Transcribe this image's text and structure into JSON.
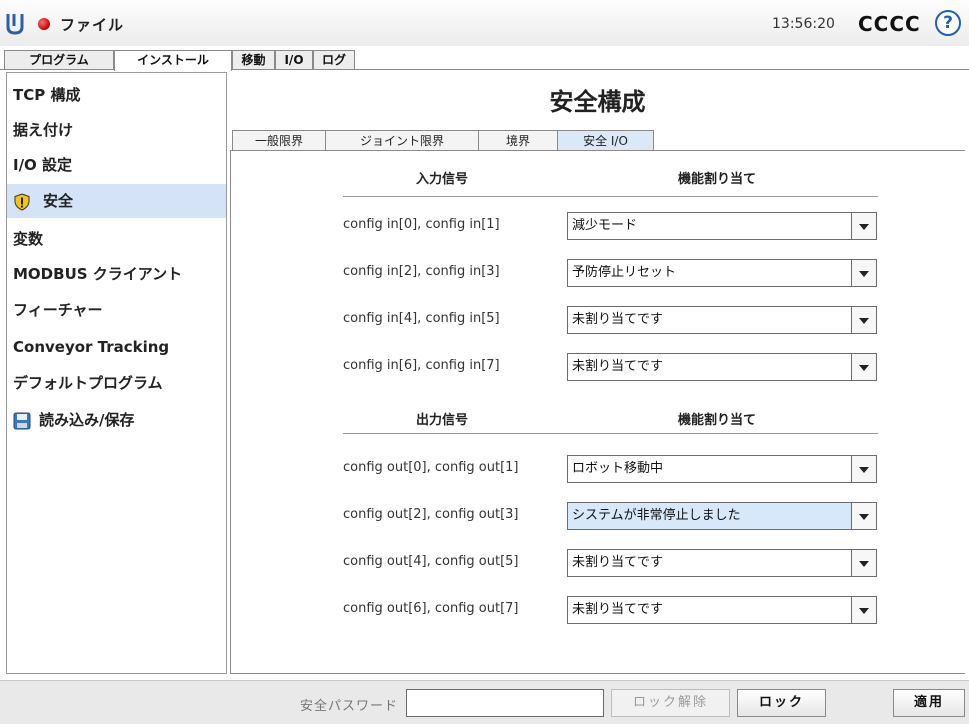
{
  "titlebar": {
    "file_menu": "ファイル",
    "clock": "13:56:20",
    "robot_name": "CCCC",
    "help_label": "?"
  },
  "top_tabs": [
    "プログラム",
    "インストール",
    "移動",
    "I/O",
    "ログ"
  ],
  "nav": {
    "items": [
      {
        "label": "TCP 構成",
        "icon": ""
      },
      {
        "label": "据え付け",
        "icon": ""
      },
      {
        "label": "I/O 設定",
        "icon": ""
      },
      {
        "label": "安全",
        "icon": "warning-icon"
      },
      {
        "label": "変数",
        "icon": ""
      },
      {
        "label": "MODBUS クライアント",
        "icon": ""
      },
      {
        "label": "フィーチャー",
        "icon": ""
      },
      {
        "label": "Conveyor Tracking",
        "icon": ""
      },
      {
        "label": "デフォルトプログラム",
        "icon": ""
      },
      {
        "label": "読み込み/保存",
        "icon": "save-icon"
      }
    ]
  },
  "main": {
    "title": "安全構成",
    "tabs": [
      "一般限界",
      "ジョイント限界",
      "境界",
      "安全 I/O"
    ],
    "input_header": "入力信号",
    "input_func_header": "機能割り当て",
    "inputs": [
      {
        "label": "config in[0], config in[1]",
        "value": "減少モード"
      },
      {
        "label": "config in[2], config in[3]",
        "value": "予防停止リセット"
      },
      {
        "label": "config in[4], config in[5]",
        "value": "未割り当てです"
      },
      {
        "label": "config in[6], config in[7]",
        "value": "未割り当てです"
      }
    ],
    "output_header": "出力信号",
    "output_func_header": "機能割り当て",
    "outputs": [
      {
        "label": "config out[0], config out[1]",
        "value": "ロボット移動中"
      },
      {
        "label": "config out[2], config out[3]",
        "value": "システムが非常停止しました"
      },
      {
        "label": "config out[4], config out[5]",
        "value": "未割り当てです"
      },
      {
        "label": "config out[6], config out[7]",
        "value": "未割り当てです"
      }
    ]
  },
  "bottom": {
    "password_label": "安全パスワード",
    "password_value": "",
    "unlock_label": "ロック解除",
    "lock_label": "ロック",
    "apply_label": "適用"
  },
  "colors": {
    "selection": "#d4e3f7",
    "alert_red": "#c40000",
    "help_blue": "#1f5fb8"
  }
}
